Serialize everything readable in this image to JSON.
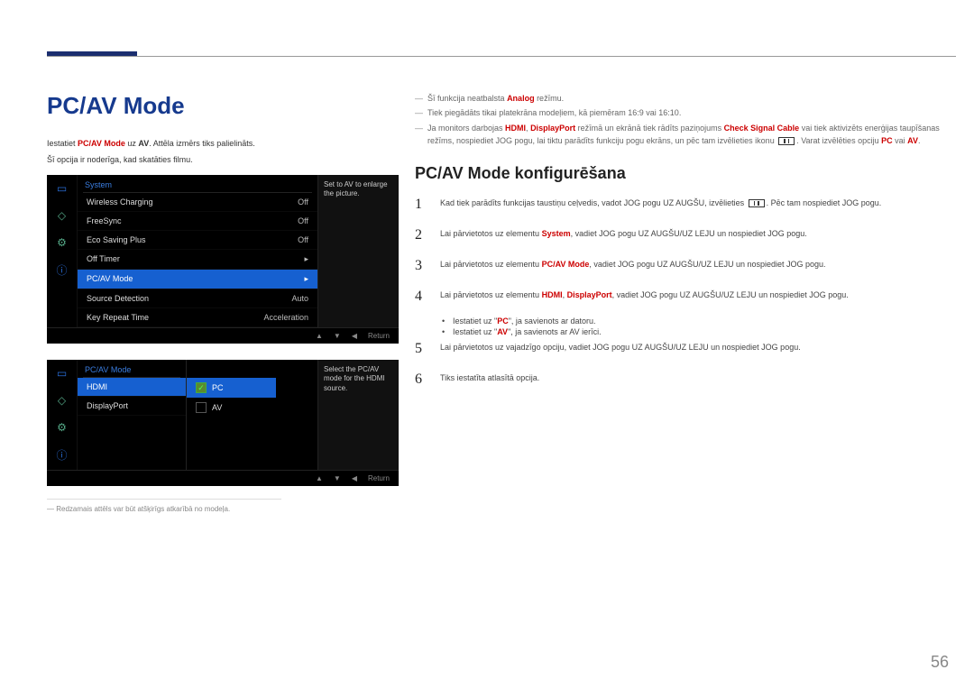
{
  "page_number": "56",
  "title": "PC/AV Mode",
  "intro": {
    "line1_prefix": "Iestatiet ",
    "line1_bold": "PC/AV Mode",
    "line1_mid": " uz ",
    "line1_bold2": "AV",
    "line1_suffix": ". Attēla izmērs tiks palielināts.",
    "line2": "Šī opcija ir noderīga, kad skatāties filmu."
  },
  "osd1": {
    "header": "System",
    "hint": "Set to AV to enlarge the picture.",
    "rows": [
      {
        "label": "Wireless Charging",
        "val": "Off"
      },
      {
        "label": "FreeSync",
        "val": "Off"
      },
      {
        "label": "Eco Saving Plus",
        "val": "Off"
      },
      {
        "label": "Off Timer",
        "val": "▸"
      },
      {
        "label": "PC/AV Mode",
        "val": "▸",
        "selected": true
      },
      {
        "label": "Source Detection",
        "val": "Auto"
      },
      {
        "label": "Key Repeat Time",
        "val": "Acceleration"
      }
    ],
    "footer_return": "Return"
  },
  "osd2": {
    "header": "PC/AV Mode",
    "hint": "Select the PC/AV mode for the HDMI source.",
    "left_rows": [
      {
        "label": "HDMI",
        "selected": true
      },
      {
        "label": "DisplayPort"
      }
    ],
    "mid_rows": [
      {
        "label": "PC",
        "checked": true,
        "selected": true
      },
      {
        "label": "AV",
        "checked": false
      }
    ],
    "footer_return": "Return"
  },
  "image_note": "― Redzamais attēls var būt atšķirīgs atkarībā no modeļa.",
  "notes": {
    "n1_pre": "Šī funkcija neatbalsta ",
    "n1_bold": "Analog",
    "n1_post": " režīmu.",
    "n2": "Tiek piegādāts tikai platekrāna modeļiem, kā piemēram 16:9 vai 16:10.",
    "n3_a": "Ja monitors darbojas ",
    "n3_b": "HDMI",
    "n3_c": ", ",
    "n3_d": "DisplayPort",
    "n3_e": " režīmā un ekrānā tiek rādīts paziņojums ",
    "n3_f": "Check Signal Cable",
    "n3_g": " vai tiek aktivizēts enerģijas taupīšanas režīms, nospiediet JOG pogu, lai tiktu parādīts funkciju pogu ekrāns, un pēc tam izvēlieties ikonu ",
    "n3_h": ". Varat izvēlēties opciju ",
    "n3_i": "PC",
    "n3_j": " vai ",
    "n3_k": "AV",
    "n3_l": "."
  },
  "subheading": "PC/AV Mode konfigurēšana",
  "steps": {
    "s1_a": "Kad tiek parādīts funkcijas taustiņu ceļvedis, vadot JOG pogu UZ AUGŠU, izvēlieties ",
    "s1_b": ". Pēc tam nospiediet JOG pogu.",
    "s2_a": "Lai pārvietotos uz elementu ",
    "s2_b": "System",
    "s2_c": ", vadiet JOG pogu UZ AUGŠU/UZ LEJU un nospiediet JOG pogu.",
    "s3_a": "Lai pārvietotos uz elementu ",
    "s3_b": "PC/AV Mode",
    "s3_c": ", vadiet JOG pogu UZ AUGŠU/UZ LEJU un nospiediet JOG pogu.",
    "s4_a": "Lai pārvietotos uz elementu ",
    "s4_b": "HDMI",
    "s4_c": ", ",
    "s4_d": "DisplayPort",
    "s4_e": ", vadiet JOG pogu UZ AUGŠU/UZ LEJU un nospiediet JOG pogu.",
    "s4_sub1_a": "Iestatiet uz \"",
    "s4_sub1_b": "PC",
    "s4_sub1_c": "\", ja savienots ar datoru.",
    "s4_sub2_a": "Iestatiet uz \"",
    "s4_sub2_b": "AV",
    "s4_sub2_c": "\", ja savienots ar AV ierīci.",
    "s5": "Lai pārvietotos uz vajadzīgo opciju, vadiet JOG pogu UZ AUGŠU/UZ LEJU un nospiediet JOG pogu.",
    "s6": "Tiks iestatīta atlasītā opcija."
  }
}
